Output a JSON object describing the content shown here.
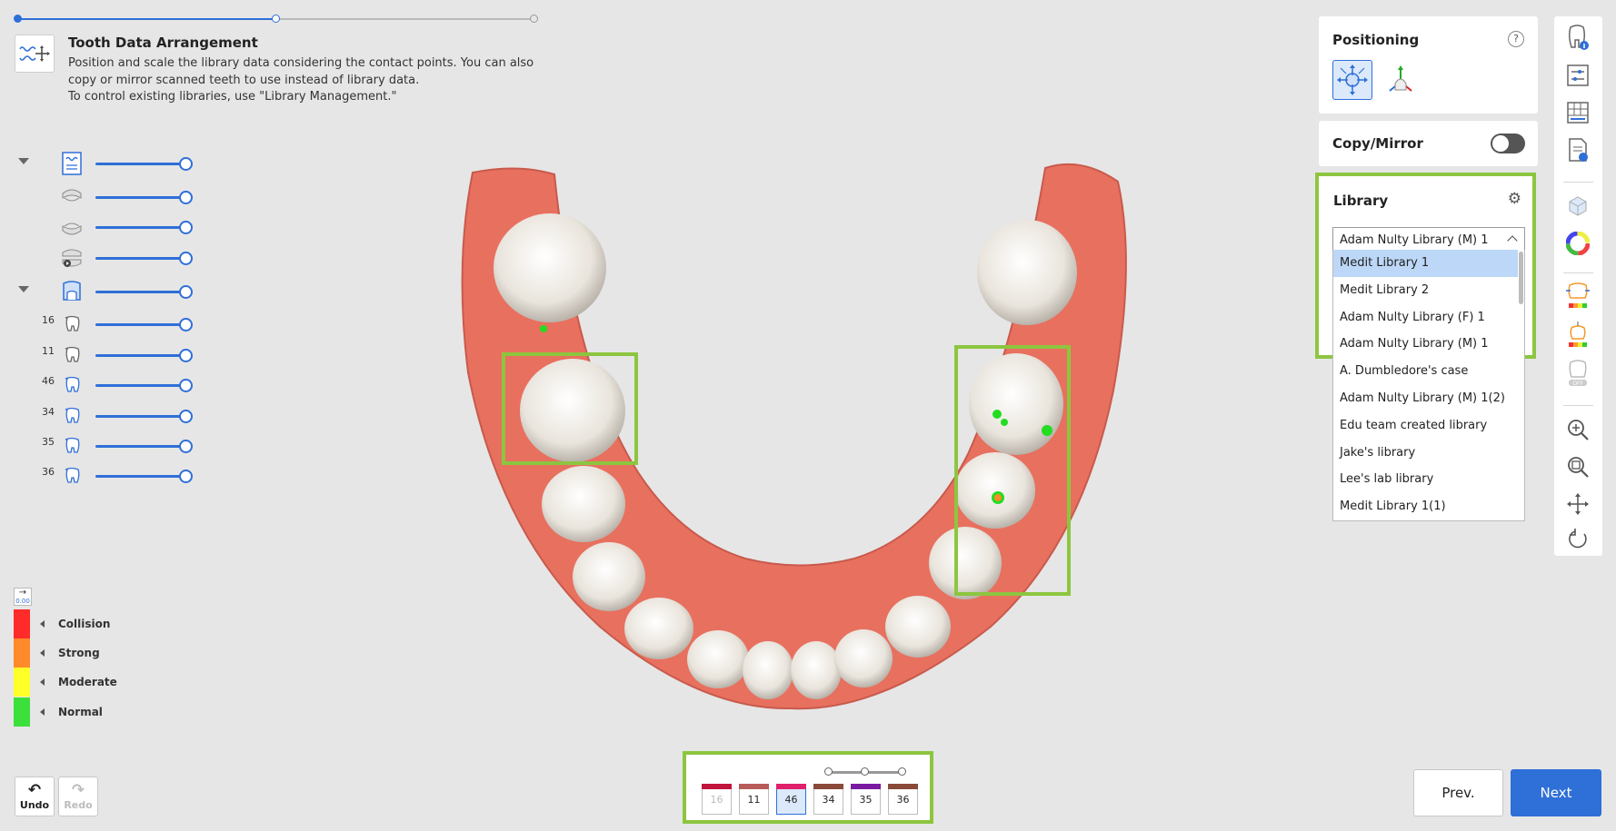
{
  "progress": {
    "steps": 3,
    "current_step": 2
  },
  "header": {
    "icon": "tooth-arrangement-icon",
    "title": "Tooth Data Arrangement",
    "description_lines": [
      "Position and scale the library data considering the contact points. You can also",
      "copy or mirror scanned teeth to use instead of library data.",
      "To control existing libraries, use \"Library Management.\""
    ]
  },
  "tree": {
    "rows": [
      {
        "icon": "scan-data-icon",
        "expandable": true,
        "opacity": 1.0
      },
      {
        "icon": "upper-jaw-icon",
        "opacity": 1.0
      },
      {
        "icon": "lower-jaw-icon",
        "opacity": 1.0
      },
      {
        "icon": "occlusion-icon",
        "opacity": 1.0
      },
      {
        "icon": "library-tooth-icon",
        "expandable": true,
        "opacity": 1.0
      },
      {
        "num": "16",
        "icon": "tooth-icon",
        "opacity": 1.0
      },
      {
        "num": "11",
        "icon": "tooth-icon",
        "opacity": 1.0
      },
      {
        "num": "46",
        "icon": "tooth-icon",
        "opacity": 1.0
      },
      {
        "num": "34",
        "icon": "tooth-icon",
        "opacity": 1.0
      },
      {
        "num": "35",
        "icon": "tooth-icon",
        "opacity": 1.0
      },
      {
        "num": "36",
        "icon": "tooth-icon",
        "opacity": 1.0
      }
    ]
  },
  "legend": {
    "scale_value": "0.00",
    "items": [
      {
        "label": "Collision",
        "color": "#ff2a2a"
      },
      {
        "label": "Strong",
        "color": "#ff8a2a"
      },
      {
        "label": "Moderate",
        "color": "#ffff2a"
      },
      {
        "label": "Normal",
        "color": "#3be03b"
      }
    ]
  },
  "history": {
    "undo_label": "Undo",
    "redo_label": "Redo"
  },
  "tooth_bar": {
    "teeth": [
      {
        "num": "16",
        "color": "#c0143c",
        "state": "dim"
      },
      {
        "num": "11",
        "color": "#b85a5a",
        "state": "normal"
      },
      {
        "num": "46",
        "color": "#e0206a",
        "state": "selected"
      },
      {
        "num": "34",
        "color": "#8a4a3a",
        "state": "normal"
      },
      {
        "num": "35",
        "color": "#7a1aa0",
        "state": "normal"
      },
      {
        "num": "36",
        "color": "#8a4a3a",
        "state": "normal"
      }
    ]
  },
  "positioning": {
    "title": "Positioning",
    "help": "?"
  },
  "copy_mirror": {
    "title": "Copy/Mirror",
    "enabled": false
  },
  "library": {
    "title": "Library",
    "selected": "Adam Nulty Library (M) 1",
    "options": [
      "Medit Library 1",
      "Medit Library 2",
      "Adam Nulty Library (F) 1",
      "Adam Nulty Library (M) 1",
      "A. Dumbledore's case",
      "Adam Nulty Library (M) 1(2)",
      "Edu team created library",
      "Jake's library",
      "Lee's lab library",
      "Medit Library 1(1)"
    ],
    "highlighted_index": 0
  },
  "toolbar": {
    "icons": [
      "tooth-info-icon",
      "settings-sliders-icon",
      "grid-icon",
      "document-icon",
      "cube-icon",
      "color-wheel-icon",
      "tooth-contact-icon",
      "tooth-distance-icon",
      "tooth-off-icon",
      "zoom-in-icon",
      "zoom-fit-icon",
      "pan-icon",
      "rotate-icon"
    ]
  },
  "navigation": {
    "prev_label": "Prev.",
    "next_label": "Next"
  },
  "colors": {
    "accent": "#2f6fd8",
    "highlight": "#8cc63f",
    "gum": "#e8705f"
  }
}
